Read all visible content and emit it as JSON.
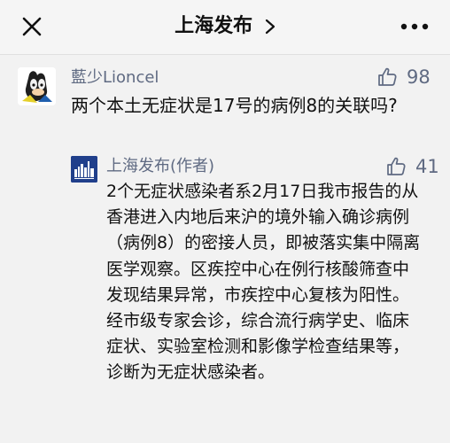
{
  "header": {
    "title": "上海发布"
  },
  "comment": {
    "author": "藍少Lioncel",
    "likes": "98",
    "text": "两个本土无症状是17号的病例8的关联吗?",
    "reply": {
      "author": "上海发布(作者)",
      "likes": "41",
      "text": "2个无症状感染者系2月17日我市报告的从香港进入内地后来沪的境外输入确诊病例（病例8）的密接人员，即被落实集中隔离医学观察。区疾控中心在例行核酸筛查中发现结果异常，市疾控中心复核为阳性。经市级专家会诊，综合流行病学史、临床症状、实验室检测和影像学检查结果等，诊断为无症状感染者。"
    }
  },
  "colors": {
    "accent": "#5f6a82",
    "background": "#f2f2f2"
  },
  "icons": {
    "close": "close-icon",
    "chevron": "chevron-right-icon",
    "more": "more-icon",
    "like": "thumbs-up-icon",
    "avatar": "user-avatar",
    "logo": "shanghai-fabu-logo"
  }
}
